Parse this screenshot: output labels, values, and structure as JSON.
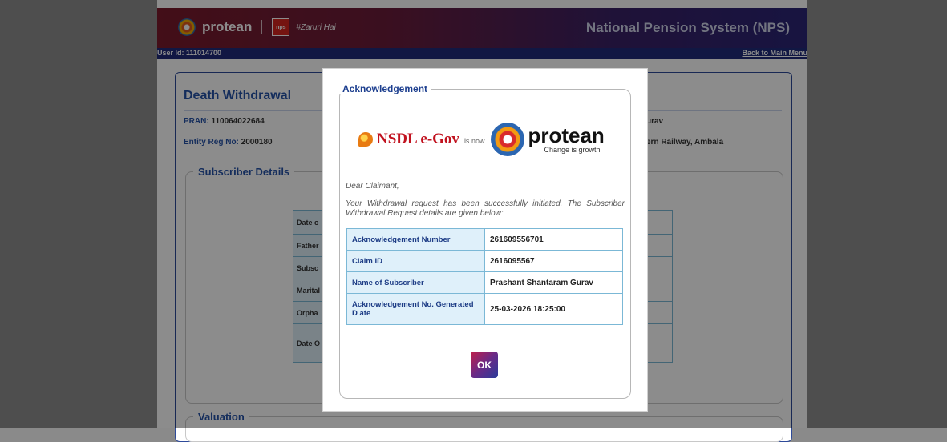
{
  "header": {
    "brand": "protean",
    "nps_badge": "nps",
    "tagline": "#Zaruri Hai",
    "title": "National Pension System (NPS)"
  },
  "subbar": {
    "user_id": "User Id: 111014700",
    "back_link": "Back to Main Menu"
  },
  "form": {
    "title": "Death Withdrawal",
    "pran_label": "PRAN:",
    "pran_value": "110064022684",
    "entity_label": "Entity Reg No:",
    "entity_value": "2000180",
    "right_value_1": "urav",
    "right_value_2": "ern Railway, Ambala",
    "section_subscriber": "Subscriber Details",
    "section_valuation": "Valuation",
    "subscriber_rows": [
      "Date o",
      "Father",
      "Subsc",
      "Marital",
      "Orpha",
      "Date O"
    ]
  },
  "modal": {
    "legend": "Acknowledgement",
    "nsdl_text": "NSDL e-Gov",
    "is_now": "is now",
    "protean_word": "protean",
    "protean_tag": "Change is growth",
    "greeting": "Dear Claimant,",
    "message": "Your Withdrawal request has been successfully initiated. The Subscriber Withdrawal Request details are given below:",
    "rows": [
      {
        "label": "Acknowledgement Number",
        "value": "261609556701"
      },
      {
        "label": "Claim ID",
        "value": "2616095567"
      },
      {
        "label": "Name of Subscriber",
        "value": "Prashant Shantaram Gurav"
      },
      {
        "label": "Acknowledgement No. Generated D ate",
        "value": "25-03-2026 18:25:00"
      }
    ],
    "ok_label": "OK"
  }
}
